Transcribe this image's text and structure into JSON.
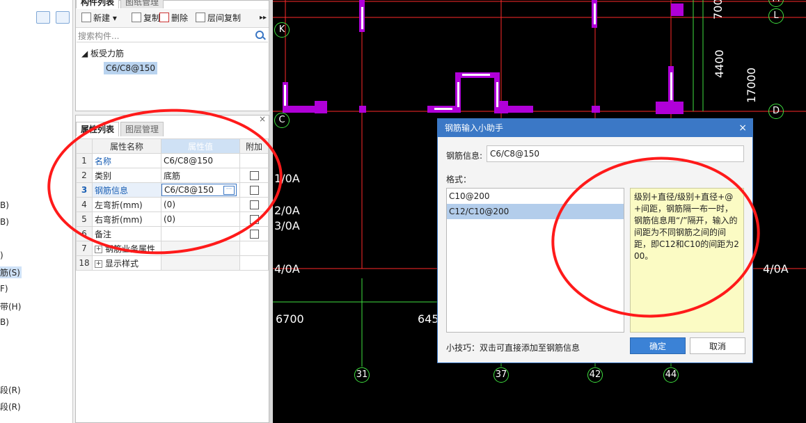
{
  "left_strip": {
    "items": [
      "B)",
      "B)",
      ")",
      "筋(S)",
      "F)",
      "带(H)",
      "B)",
      "段(R)",
      "段(R)"
    ],
    "selected_index": 3
  },
  "component_list": {
    "tabs": [
      "构件列表",
      "图纸管理"
    ],
    "toolbar": {
      "new": "新建",
      "copy": "复制",
      "delete": "删除",
      "floor_copy": "层间复制",
      "more": "▸▸"
    },
    "search_placeholder": "搜索构件...",
    "tree": {
      "group": "板受力筋",
      "item": "C6/C8@150"
    }
  },
  "properties": {
    "tabs": [
      "属性列表",
      "图层管理"
    ],
    "close": "×",
    "headers": {
      "name": "属性名称",
      "value": "属性值",
      "extra": "附加"
    },
    "rows": [
      {
        "idx": "1",
        "name": "名称",
        "value": "C6/C8@150",
        "blue": true,
        "checkbox": false
      },
      {
        "idx": "2",
        "name": "类别",
        "value": "底筋",
        "blue": false,
        "checkbox": true
      },
      {
        "idx": "3",
        "name": "钢筋信息",
        "value": "C6/C8@150",
        "blue": true,
        "checkbox": true
      },
      {
        "idx": "4",
        "name": "左弯折(mm)",
        "value": "(0)",
        "blue": false,
        "checkbox": true
      },
      {
        "idx": "5",
        "name": "右弯折(mm)",
        "value": "(0)",
        "blue": false,
        "checkbox": true
      },
      {
        "idx": "6",
        "name": "备注",
        "value": "",
        "blue": false,
        "checkbox": true
      },
      {
        "idx": "7",
        "name": "钢筋业务属性",
        "value": "",
        "blue": false,
        "checkbox": false,
        "expand": "+"
      },
      {
        "idx": "18",
        "name": "显示样式",
        "value": "",
        "blue": false,
        "checkbox": false,
        "expand": "+"
      }
    ],
    "dots": "···"
  },
  "cad": {
    "grid_labels": {
      "K": "K",
      "C": "C",
      "M": "M",
      "L": "L",
      "D": "D",
      "a1": "1/0A",
      "a2": "2/0A",
      "a3": "3/0A",
      "a4": "4/0A",
      "a4r": "4/0A",
      "b31": "31",
      "b37": "37",
      "b42": "42",
      "b44": "44"
    },
    "dims": {
      "d700": "700",
      "d4400": "4400",
      "d17000": "17000",
      "d6700": "6700",
      "d645": "645"
    }
  },
  "dialog": {
    "title": "钢筋输入小助手",
    "close": "×",
    "info_label": "钢筋信息:",
    "info_value": "C6/C8@150",
    "format_label": "格式：",
    "formats": [
      "C10@200",
      "C12/C10@200"
    ],
    "selected_format": 1,
    "help_text": "级别+直径/级别+直径+@+间距，钢筋隔一布一时，钢筋信息用“/”隔开，输入的间距为不同钢筋之间的间距，即C12和C10的间距为200。",
    "tip": "小技巧：双击可直接添加至钢筋信息",
    "ok": "确定",
    "cancel": "取消"
  },
  "colors": {
    "accent": "#3b78c6",
    "annotation": "#ff1a1a",
    "cad_red": "#ff2a2a",
    "cad_green": "#3fe03f",
    "cad_magenta": "#b000d8"
  }
}
